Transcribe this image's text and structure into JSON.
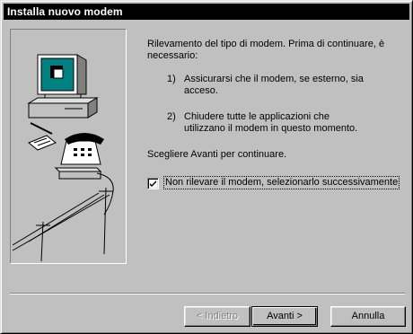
{
  "window": {
    "title": "Installa nuovo modem"
  },
  "illustration": {
    "icon": "computer-telephone-modem-icon"
  },
  "content": {
    "intro": "Rilevamento del tipo di modem. Prima di continuare, è necessario:",
    "steps": [
      {
        "number": "1)",
        "text": "Assicurarsi che il modem, se esterno, sia acceso."
      },
      {
        "number": "2)",
        "text": "Chiudere tutte le applicazioni che utilizzano il modem in questo momento."
      }
    ],
    "instruction": "Scegliere Avanti per continuare."
  },
  "checkbox": {
    "label": "Non rilevare il modem, selezionarlo successivamente",
    "checked": true
  },
  "buttons": {
    "back": "< Indietro",
    "next": "Avanti >",
    "cancel": "Annulla"
  }
}
